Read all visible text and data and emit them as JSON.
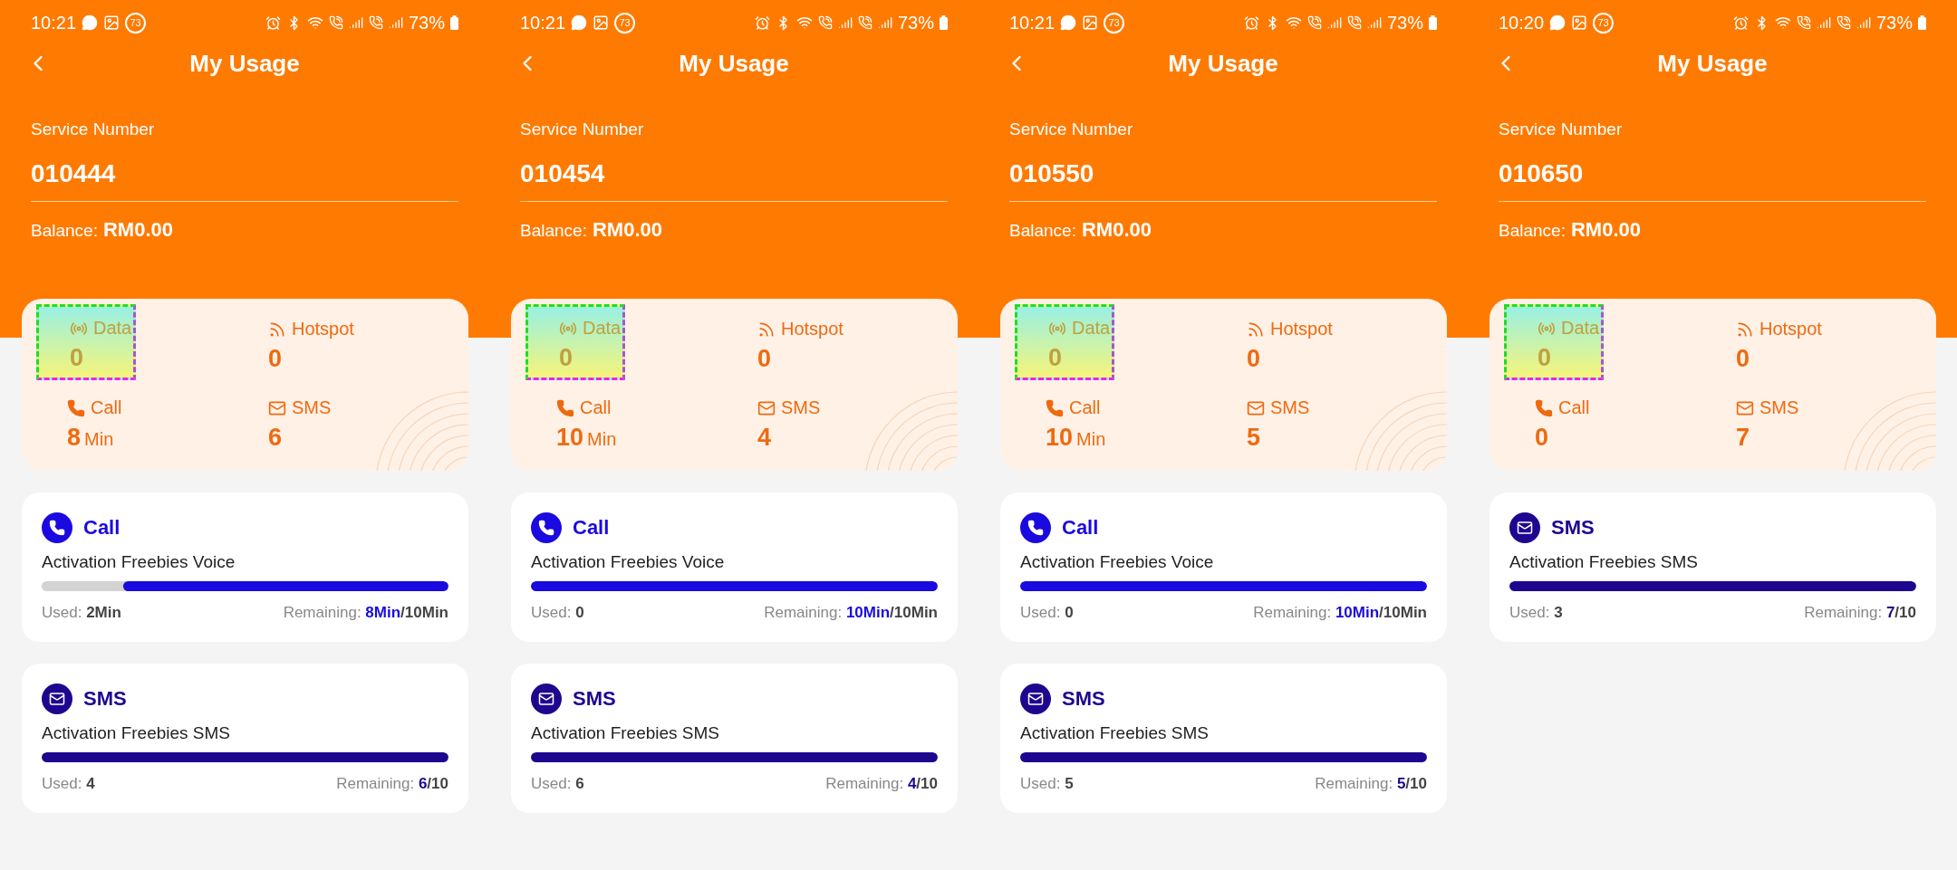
{
  "phones": [
    {
      "status_bar": {
        "time": "10:21",
        "badge": "73",
        "battery": "73%"
      },
      "title": "My Usage",
      "service_label": "Service Number",
      "service_number": "010444",
      "balance_label": "Balance:",
      "balance_value": "RM0.00",
      "stats": [
        {
          "kind": "data",
          "label": "Data",
          "value": "0",
          "highlighted": true
        },
        {
          "kind": "hotspot",
          "label": "Hotspot",
          "value": "0",
          "highlighted": false
        },
        {
          "kind": "call",
          "label": "Call",
          "value": "8",
          "unit": "Min",
          "highlighted": false
        },
        {
          "kind": "sms",
          "label": "SMS",
          "value": "6",
          "highlighted": false
        }
      ],
      "usage_cards": [
        {
          "kind": "call",
          "title": "Call",
          "plan": "Activation Freebies Voice",
          "level": 0.8,
          "used_label": "Used:",
          "used_value": "2Min",
          "remaining_label": "Remaining:",
          "remaining_value": "8Min",
          "remaining_total": "/10Min"
        },
        {
          "kind": "sms",
          "title": "SMS",
          "plan": "Activation Freebies SMS",
          "level": 1,
          "used_label": "Used:",
          "used_value": "4",
          "remaining_label": "Remaining:",
          "remaining_value": "6",
          "remaining_total": "/10"
        }
      ]
    },
    {
      "status_bar": {
        "time": "10:21",
        "badge": "73",
        "battery": "73%"
      },
      "title": "My Usage",
      "service_label": "Service Number",
      "service_number": "010454",
      "balance_label": "Balance:",
      "balance_value": "RM0.00",
      "stats": [
        {
          "kind": "data",
          "label": "Data",
          "value": "0",
          "highlighted": true
        },
        {
          "kind": "hotspot",
          "label": "Hotspot",
          "value": "0",
          "highlighted": false
        },
        {
          "kind": "call",
          "label": "Call",
          "value": "10",
          "unit": "Min",
          "highlighted": false
        },
        {
          "kind": "sms",
          "label": "SMS",
          "value": "4",
          "highlighted": false
        }
      ],
      "usage_cards": [
        {
          "kind": "call",
          "title": "Call",
          "plan": "Activation Freebies Voice",
          "level": 1,
          "used_label": "Used:",
          "used_value": "0",
          "remaining_label": "Remaining:",
          "remaining_value": "10Min",
          "remaining_total": "/10Min"
        },
        {
          "kind": "sms",
          "title": "SMS",
          "plan": "Activation Freebies SMS",
          "level": 1,
          "used_label": "Used:",
          "used_value": "6",
          "remaining_label": "Remaining:",
          "remaining_value": "4",
          "remaining_total": "/10"
        }
      ]
    },
    {
      "status_bar": {
        "time": "10:21",
        "badge": "73",
        "battery": "73%"
      },
      "title": "My Usage",
      "service_label": "Service Number",
      "service_number": "010550",
      "balance_label": "Balance:",
      "balance_value": "RM0.00",
      "stats": [
        {
          "kind": "data",
          "label": "Data",
          "value": "0",
          "highlighted": true
        },
        {
          "kind": "hotspot",
          "label": "Hotspot",
          "value": "0",
          "highlighted": false
        },
        {
          "kind": "call",
          "label": "Call",
          "value": "10",
          "unit": "Min",
          "highlighted": false
        },
        {
          "kind": "sms",
          "label": "SMS",
          "value": "5",
          "highlighted": false
        }
      ],
      "usage_cards": [
        {
          "kind": "call",
          "title": "Call",
          "plan": "Activation Freebies Voice",
          "level": 1,
          "used_label": "Used:",
          "used_value": "0",
          "remaining_label": "Remaining:",
          "remaining_value": "10Min",
          "remaining_total": "/10Min"
        },
        {
          "kind": "sms",
          "title": "SMS",
          "plan": "Activation Freebies SMS",
          "level": 1,
          "used_label": "Used:",
          "used_value": "5",
          "remaining_label": "Remaining:",
          "remaining_value": "5",
          "remaining_total": "/10"
        }
      ]
    },
    {
      "status_bar": {
        "time": "10:20",
        "badge": "73",
        "battery": "73%"
      },
      "title": "My Usage",
      "service_label": "Service Number",
      "service_number": "010650",
      "balance_label": "Balance:",
      "balance_value": "RM0.00",
      "stats": [
        {
          "kind": "data",
          "label": "Data",
          "value": "0",
          "highlighted": true
        },
        {
          "kind": "hotspot",
          "label": "Hotspot",
          "value": "0",
          "highlighted": false
        },
        {
          "kind": "call",
          "label": "Call",
          "value": "0",
          "highlighted": false
        },
        {
          "kind": "sms",
          "label": "SMS",
          "value": "7",
          "highlighted": false
        }
      ],
      "usage_cards": [
        {
          "kind": "sms",
          "title": "SMS",
          "plan": "Activation Freebies SMS",
          "level": 1,
          "used_label": "Used:",
          "used_value": "3",
          "remaining_label": "Remaining:",
          "remaining_value": "7",
          "remaining_total": "/10"
        }
      ]
    }
  ]
}
